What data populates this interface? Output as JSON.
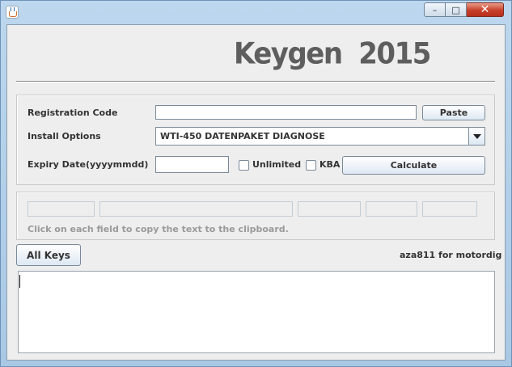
{
  "window": {
    "title": "",
    "minimize_glyph": "–",
    "maximize_glyph": "□",
    "close_glyph": "✕"
  },
  "header": {
    "title": "Keygen  2015"
  },
  "form": {
    "registration_code": {
      "label": "Registration Code",
      "value": ""
    },
    "paste_button": "Paste",
    "install_options": {
      "label": "Install Options",
      "selected": "WTI-450 DATENPAKET DIAGNOSE"
    },
    "expiry_date": {
      "label": "Expiry Date(yyyymmdd)",
      "value": ""
    },
    "unlimited_label": "Unlimited",
    "kba_label": "KBA",
    "calculate_button": "Calculate"
  },
  "keys": {
    "fields": [
      "",
      "",
      "",
      "",
      ""
    ],
    "hint": "Click on each field to copy the text to the clipboard."
  },
  "footer": {
    "all_keys_button": "All Keys",
    "credit": "aza811 for motordig"
  },
  "output": {
    "text": ""
  }
}
